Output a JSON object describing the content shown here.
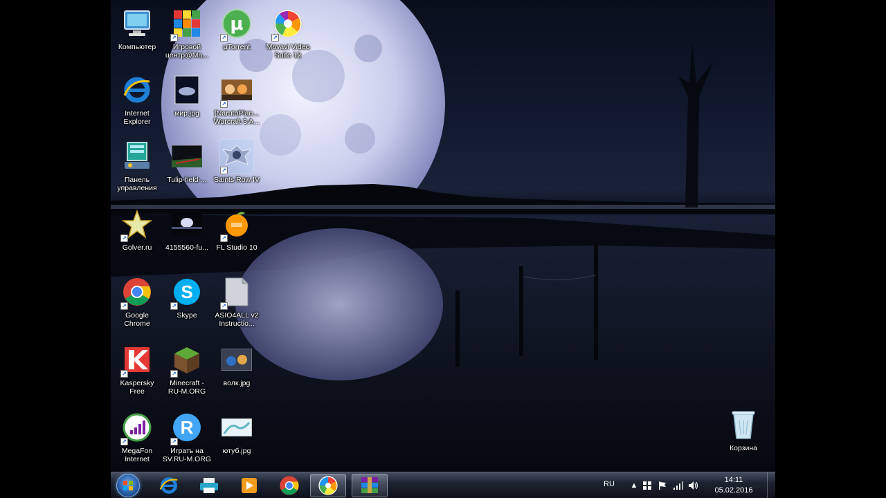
{
  "desktop": {
    "icons": [
      {
        "label": "Компьютер",
        "icon": "computer-icon"
      },
      {
        "label": "Игровой\nцентр@Ma...",
        "icon": "game-center-icon"
      },
      {
        "label": "µTorrent",
        "icon": "utorrent-icon"
      },
      {
        "label": "Movavi Video\nSuite 12",
        "icon": "movavi-icon"
      },
      {
        "label": "Internet\nExplorer",
        "icon": "internet-explorer-icon"
      },
      {
        "label": "мир.jpg",
        "icon": "image-file-icon"
      },
      {
        "label": "[NarutoPlan...\nWarcraft 3 A...",
        "icon": "warcraft-map-icon"
      },
      {
        "label": "Панель\nуправления",
        "icon": "control-panel-icon"
      },
      {
        "label": "Tulip-field-...",
        "icon": "image-file-icon"
      },
      {
        "label": "Saints Row IV",
        "icon": "saints-row-icon"
      },
      {
        "label": "Golver.ru",
        "icon": "star-icon"
      },
      {
        "label": "4155560-fu...",
        "icon": "image-file-icon"
      },
      {
        "label": "FL Studio 10",
        "icon": "fl-studio-icon"
      },
      {
        "label": "Google\nChrome",
        "icon": "chrome-icon"
      },
      {
        "label": "Skype",
        "icon": "skype-icon"
      },
      {
        "label": "ASIO4ALL v2\nInstructio...",
        "icon": "document-icon"
      },
      {
        "label": "Kaspersky\nFree",
        "icon": "kaspersky-icon"
      },
      {
        "label": "Minecraft -\nRU-M.ORG",
        "icon": "minecraft-icon"
      },
      {
        "label": "волк.jpg",
        "icon": "image-file-icon"
      },
      {
        "label": "MegaFon\nInternet",
        "icon": "megafon-icon"
      },
      {
        "label": "Играть на\nSV.RU-M.ORG",
        "icon": "play-r-icon"
      },
      {
        "label": "ютуб.jpg",
        "icon": "image-file-icon"
      },
      {
        "label": "Корзина",
        "icon": "recycle-bin-icon"
      }
    ]
  },
  "taskbar": {
    "pinned": [
      {
        "name": "internet-explorer",
        "icon": "internet-explorer-icon"
      },
      {
        "name": "printer",
        "icon": "printer-icon"
      },
      {
        "name": "media-player",
        "icon": "media-player-icon"
      },
      {
        "name": "chrome",
        "icon": "chrome-icon"
      },
      {
        "name": "movavi",
        "icon": "movavi-icon"
      },
      {
        "name": "winrar",
        "icon": "winrar-icon"
      }
    ],
    "language": "RU",
    "clock": {
      "time": "14:11",
      "date": "05.02.2016"
    }
  },
  "colors": {
    "sky": "#0a0e1c",
    "moon": "#c8ccea",
    "taskbar": "#1e2432",
    "ie_blue": "#1e7fd8",
    "chrome_red": "#db4437",
    "chrome_yellow": "#f4c20d",
    "chrome_green": "#0f9d58"
  }
}
